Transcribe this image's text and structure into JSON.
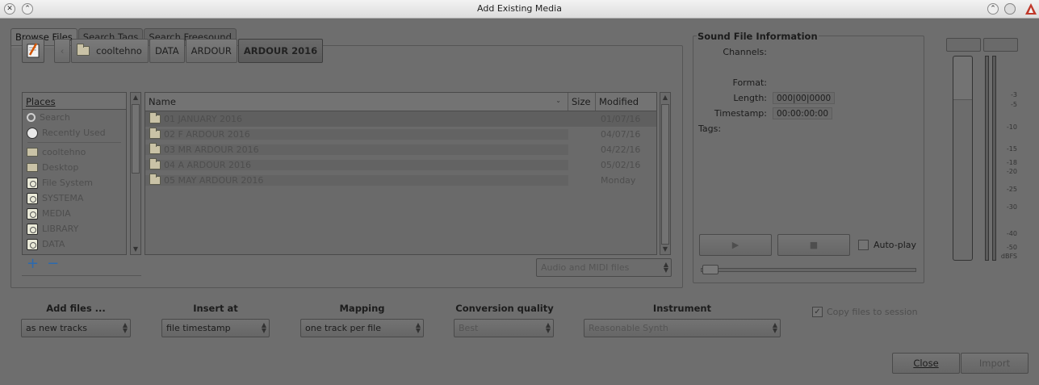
{
  "window": {
    "title": "Add Existing Media"
  },
  "tabs": [
    {
      "label": "Browse Files"
    },
    {
      "label": "Search Tags"
    },
    {
      "label": "Search Freesound"
    }
  ],
  "breadcrumb": [
    "cooltehno",
    "DATA",
    "ARDOUR",
    "ARDOUR 2016"
  ],
  "places": {
    "header": "Places",
    "items": [
      {
        "label": "Search",
        "icon": "search-icon"
      },
      {
        "label": "Recently Used",
        "icon": "clock-icon"
      },
      {
        "label": "cooltehno",
        "icon": "folder-icon"
      },
      {
        "label": "Desktop",
        "icon": "folder-icon"
      },
      {
        "label": "File System",
        "icon": "drive-icon"
      },
      {
        "label": "SYSTEMA",
        "icon": "drive-icon"
      },
      {
        "label": "MEDIA",
        "icon": "drive-icon"
      },
      {
        "label": "LIBRARY",
        "icon": "drive-icon"
      },
      {
        "label": "DATA",
        "icon": "drive-icon"
      }
    ]
  },
  "files": {
    "columns": [
      "Name",
      "Size",
      "Modified"
    ],
    "rows": [
      {
        "name": "01 JANUARY 2016",
        "size": "",
        "modified": "01/07/16"
      },
      {
        "name": "02 F ARDOUR 2016",
        "size": "",
        "modified": "04/07/16"
      },
      {
        "name": "03 MR ARDOUR 2016",
        "size": "",
        "modified": "04/22/16"
      },
      {
        "name": "04 A ARDOUR 2016",
        "size": "",
        "modified": "05/02/16"
      },
      {
        "name": "05 MAY ARDOUR 2016",
        "size": "",
        "modified": "Monday"
      }
    ]
  },
  "filter": {
    "value": "Audio and MIDI files"
  },
  "sound_info": {
    "title": "Sound File Information",
    "channels_label": "Channels:",
    "format_label": "Format:",
    "length_label": "Length:",
    "length_value": "000|00|0000",
    "timestamp_label": "Timestamp:",
    "timestamp_value": "00:00:00:00",
    "tags_label": "Tags:",
    "autoplay_label": "Auto-play",
    "play_symbol": "▶",
    "stop_symbol": "■"
  },
  "meter": {
    "scale": [
      "-3",
      "-5",
      "-10",
      "-15",
      "-18",
      "-20",
      "-25",
      "-30",
      "-40",
      "-50",
      "dBFS"
    ]
  },
  "options": {
    "add_files": {
      "label": "Add files ...",
      "value": "as new tracks"
    },
    "insert_at": {
      "label": "Insert at",
      "value": "file timestamp"
    },
    "mapping": {
      "label": "Mapping",
      "value": "one track per file"
    },
    "conversion": {
      "label": "Conversion quality",
      "value": "Best"
    },
    "instrument": {
      "label": "Instrument",
      "value": "Reasonable Synth"
    },
    "copy_files": {
      "label": "Copy files to session",
      "checked": true
    }
  },
  "buttons": {
    "close": "Close",
    "import": "Import"
  },
  "colors": {
    "background": "#6e6e6e",
    "accent": "#2b6ab0"
  }
}
